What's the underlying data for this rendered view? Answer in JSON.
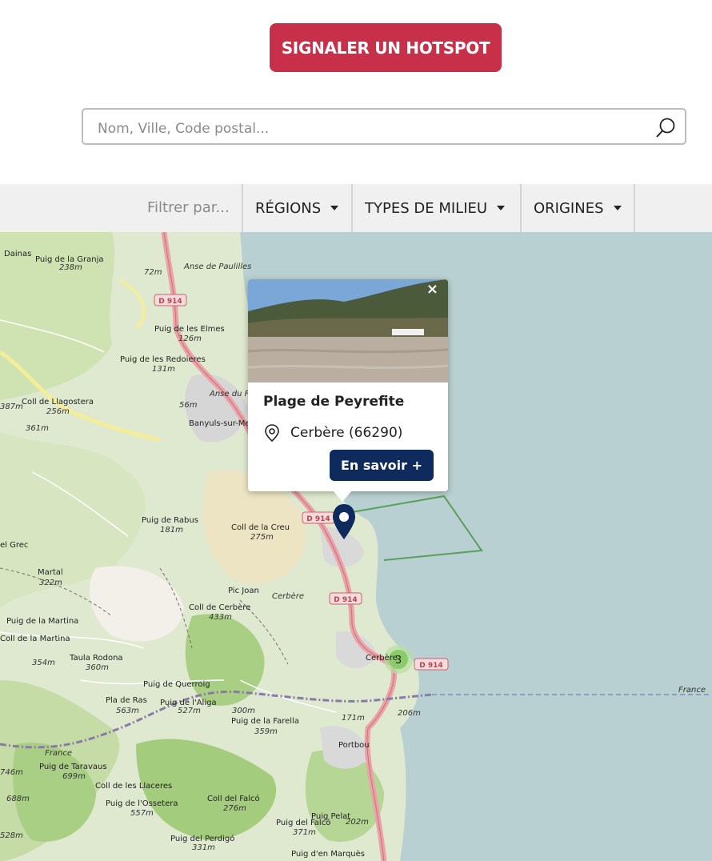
{
  "header": {
    "report_button_label": "SIGNALER UN HOTSPOT"
  },
  "search": {
    "placeholder": "Nom, Ville, Code postal..."
  },
  "filters": {
    "label": "Filtrer par...",
    "items": [
      {
        "label": "RÉGIONS"
      },
      {
        "label": "TYPES DE MILIEU"
      },
      {
        "label": "ORIGINES"
      }
    ]
  },
  "popup": {
    "close": "×",
    "title": "Plage de Peyrefite",
    "location": "Cerbère (66290)",
    "button_label": "En savoir +"
  },
  "map": {
    "cluster_count": "3",
    "roads": [
      "D 914",
      "D 914",
      "D 914",
      "D 914"
    ],
    "places": [
      "Puig de la Granja",
      "238m",
      "Anse de Paulilles",
      "72m",
      "Puig de les Elmes",
      "126m",
      "Puig de les Redoieres",
      "131m",
      "Anse du Fontaulé",
      "56m",
      "Banyuls-sur-Mer",
      "Coll de Llagostera",
      "256m",
      "387m",
      "361m",
      "Puig de Rabus",
      "181m",
      "Coll de la Creu",
      "275m",
      "el Grec",
      "Martal",
      "322m",
      "Pic Joan",
      "Cerbère",
      "Coll de Cerbère",
      "433m",
      "Puig de la Martina",
      "Coll de la Martina",
      "Taula Rodona",
      "360m",
      "354m",
      "Puig de Querroig",
      "Pla de Ras",
      "563m",
      "Puig de l'Aliga",
      "527m",
      "300m",
      "Puig de la Farella",
      "359m",
      "206m",
      "171m",
      "Portbou",
      "France",
      "Puig de Taravaus",
      "699m",
      "Coll de les Llaceres",
      "Puig de l'Ossetera",
      "557m",
      "Coll del Falcó",
      "276m",
      "Puig Pelat",
      "202m",
      "Puig del Falcó",
      "371m",
      "Puig del Perdigó",
      "331m",
      "Puig d'en Marquès",
      "746m",
      "688m",
      "528m",
      "Dainas",
      "Cerbère",
      "France"
    ]
  },
  "colors": {
    "accent_red": "#c8304a",
    "navy": "#0f2a5c",
    "sea": "#b8d0d1"
  }
}
